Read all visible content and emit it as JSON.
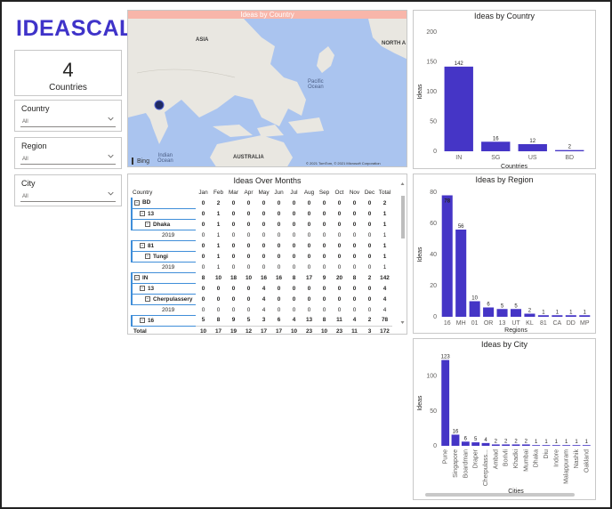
{
  "brand": {
    "logo_text": "IDEASCALE",
    "accent": "#3f33c9"
  },
  "kpi": {
    "value": "4",
    "label": "Countries"
  },
  "slicers": [
    {
      "title": "Country",
      "value": "All"
    },
    {
      "title": "Region",
      "value": "All"
    },
    {
      "title": "City",
      "value": "All"
    }
  ],
  "map": {
    "title": "Ideas by Country",
    "labels": {
      "asia": "ASIA",
      "north_a": "NORTH A",
      "pacific": "Pacific\nOcean",
      "indian": "Indian\nOcean",
      "australia": "AUSTRALIA"
    },
    "bing": "Bing",
    "copyright": "© 2021 TomTom, © 2021 Microsoft Corporation"
  },
  "matrix": {
    "title": "Ideas Over Months",
    "columns": [
      "Country",
      "Jan",
      "Feb",
      "Mar",
      "Apr",
      "May",
      "Jun",
      "Jul",
      "Aug",
      "Sep",
      "Oct",
      "Nov",
      "Dec",
      "Total"
    ],
    "rows": [
      {
        "label": "BD",
        "level": 0,
        "bold": true,
        "toggle": "−",
        "values": [
          "0",
          "2",
          "0",
          "0",
          "0",
          "0",
          "0",
          "0",
          "0",
          "0",
          "0",
          "0",
          "2"
        ]
      },
      {
        "label": "13",
        "level": 1,
        "bold": true,
        "toggle": "−",
        "values": [
          "0",
          "1",
          "0",
          "0",
          "0",
          "0",
          "0",
          "0",
          "0",
          "0",
          "0",
          "0",
          "1"
        ]
      },
      {
        "label": "Dhaka",
        "level": 2,
        "bold": true,
        "toggle": "−",
        "values": [
          "0",
          "1",
          "0",
          "0",
          "0",
          "0",
          "0",
          "0",
          "0",
          "0",
          "0",
          "0",
          "1"
        ]
      },
      {
        "label": "2019",
        "level": 3,
        "bold": false,
        "toggle": "",
        "values": [
          "0",
          "1",
          "0",
          "0",
          "0",
          "0",
          "0",
          "0",
          "0",
          "0",
          "0",
          "0",
          "1"
        ]
      },
      {
        "label": "81",
        "level": 1,
        "bold": true,
        "toggle": "−",
        "values": [
          "0",
          "1",
          "0",
          "0",
          "0",
          "0",
          "0",
          "0",
          "0",
          "0",
          "0",
          "0",
          "1"
        ]
      },
      {
        "label": "Tungi",
        "level": 2,
        "bold": true,
        "toggle": "−",
        "values": [
          "0",
          "1",
          "0",
          "0",
          "0",
          "0",
          "0",
          "0",
          "0",
          "0",
          "0",
          "0",
          "1"
        ]
      },
      {
        "label": "2019",
        "level": 3,
        "bold": false,
        "toggle": "",
        "values": [
          "0",
          "1",
          "0",
          "0",
          "0",
          "0",
          "0",
          "0",
          "0",
          "0",
          "0",
          "0",
          "1"
        ]
      },
      {
        "label": "IN",
        "level": 0,
        "bold": true,
        "toggle": "−",
        "values": [
          "8",
          "10",
          "18",
          "10",
          "16",
          "16",
          "8",
          "17",
          "9",
          "20",
          "8",
          "2",
          "142"
        ]
      },
      {
        "label": "13",
        "level": 1,
        "bold": true,
        "toggle": "−",
        "values": [
          "0",
          "0",
          "0",
          "0",
          "4",
          "0",
          "0",
          "0",
          "0",
          "0",
          "0",
          "0",
          "4"
        ]
      },
      {
        "label": "Cherpulassery",
        "level": 2,
        "bold": true,
        "toggle": "−",
        "values": [
          "0",
          "0",
          "0",
          "0",
          "4",
          "0",
          "0",
          "0",
          "0",
          "0",
          "0",
          "0",
          "4"
        ]
      },
      {
        "label": "2019",
        "level": 3,
        "bold": false,
        "toggle": "",
        "values": [
          "0",
          "0",
          "0",
          "0",
          "4",
          "0",
          "0",
          "0",
          "0",
          "0",
          "0",
          "0",
          "4"
        ]
      },
      {
        "label": "16",
        "level": 1,
        "bold": true,
        "toggle": "−",
        "values": [
          "5",
          "8",
          "9",
          "5",
          "3",
          "6",
          "4",
          "13",
          "8",
          "11",
          "4",
          "2",
          "78"
        ]
      },
      {
        "label": "Total",
        "level": 0,
        "bold": true,
        "toggle": "",
        "values": [
          "10",
          "17",
          "19",
          "12",
          "17",
          "17",
          "10",
          "23",
          "10",
          "23",
          "11",
          "3",
          "172"
        ]
      }
    ]
  },
  "chart_data": [
    {
      "type": "bar",
      "title": "Ideas by Country",
      "xlabel": "Countries",
      "ylabel": "Ideas",
      "categories": [
        "IN",
        "SG",
        "US",
        "BD"
      ],
      "values": [
        142,
        16,
        12,
        2
      ],
      "ylim": [
        0,
        200
      ],
      "yticks": [
        0,
        50,
        100,
        150,
        200
      ],
      "color": "#4535c6"
    },
    {
      "type": "bar",
      "title": "Ideas by Region",
      "xlabel": "Regions",
      "ylabel": "Ideas",
      "categories": [
        "16",
        "MH",
        "01",
        "OR",
        "13",
        "UT",
        "KL",
        "81",
        "CA",
        "DD",
        "MP"
      ],
      "values": [
        78,
        56,
        10,
        6,
        5,
        5,
        2,
        1,
        1,
        1,
        1
      ],
      "ylim": [
        0,
        80
      ],
      "yticks": [
        0,
        20,
        40,
        60,
        80
      ],
      "color": "#4535c6"
    },
    {
      "type": "bar",
      "title": "Ideas by City",
      "xlabel": "Cities",
      "ylabel": "Ideas",
      "categories": [
        "Pune",
        "Singapore",
        "Boardman",
        "Draper",
        "Cherpulass...",
        "Ambad",
        "Borivli",
        "Khadki",
        "Mumbai",
        "Dhaka",
        "Diu",
        "Indore",
        "Malappuram",
        "Nashik",
        "Oakland"
      ],
      "values": [
        123,
        16,
        6,
        5,
        4,
        2,
        2,
        2,
        2,
        1,
        1,
        1,
        1,
        1,
        1
      ],
      "ylim": [
        0,
        125
      ],
      "yticks": [
        0,
        50,
        100
      ],
      "color": "#4535c6"
    }
  ]
}
